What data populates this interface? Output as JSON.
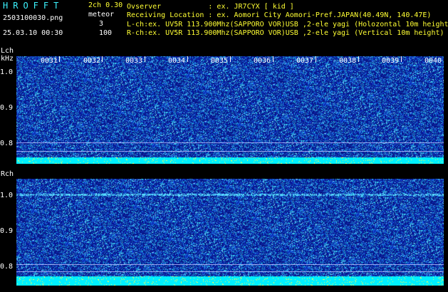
{
  "header": {
    "app_title": "HROFFT",
    "mode": "2ch 0.30",
    "filename": "2503100030.png",
    "meteor_label": "meteor",
    "meteor_count": "3",
    "datetime": "25.03.10 00:30",
    "meteor_max": "100",
    "info_lines": [
      "Ovserver           : ex. JR7CYX [ kid ]",
      "Receiving Location : ex. Aomori City Aomori-Pref.JAPAN(40.49N, 140.47E)",
      "L-ch:ex. UV5R 113.900Mhz(SAPPORO VOR)USB ,2-ele yagi (Holozontal 10m height)",
      "R-ch:ex. UV5R 113.900Mhz(SAPPORO VOR)USB ,2-ele yagi (Vertical 10m height)"
    ]
  },
  "lch": {
    "label": "Lch",
    "unit": "kHz",
    "yticks": [
      "1.0",
      "0.9",
      "0.8"
    ]
  },
  "rch": {
    "label": "Rch",
    "yticks": [
      "1.0",
      "0.9",
      "0.8"
    ]
  },
  "time_labels": [
    "0031",
    "0032",
    "0033",
    "0034",
    "0035",
    "0036",
    "0037",
    "0038",
    "0039",
    "0040"
  ],
  "colors": {
    "title_cyan": "#3cf4ff",
    "text_yellow": "#ffff33",
    "spectrogram_bg": "#0a1a8c",
    "baseline_cyan": "#00ffff"
  }
}
